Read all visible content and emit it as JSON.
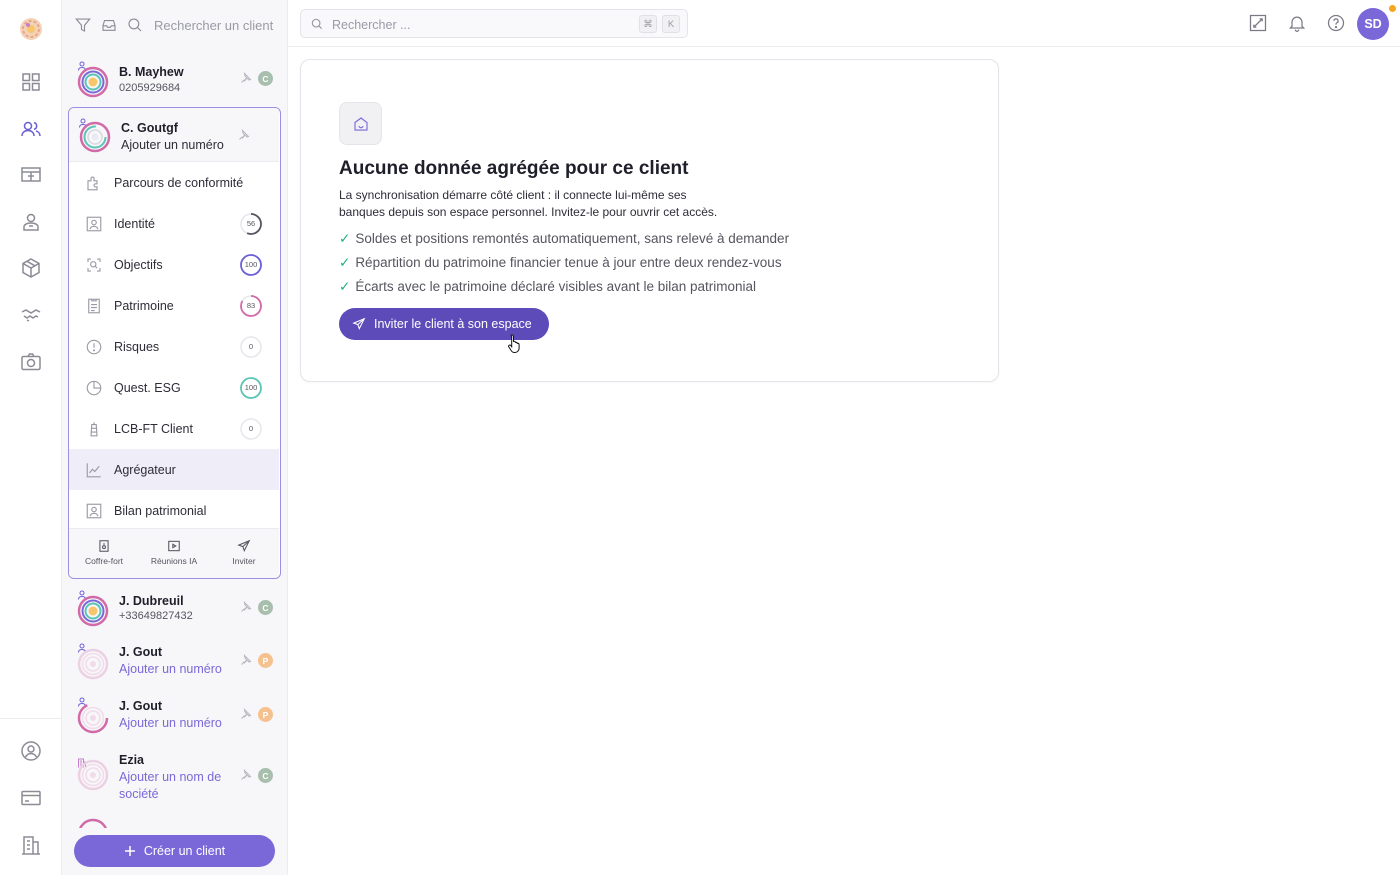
{
  "rail": {
    "icons": [
      "dashboard-icon",
      "clients-icon",
      "presentation-icon",
      "advisor-icon",
      "package-icon",
      "handshake-icon",
      "camera-icon"
    ],
    "bottom_icons": [
      "user-circle-icon",
      "card-icon",
      "building-icon"
    ]
  },
  "clients_panel": {
    "search_placeholder": "Rechercher un client",
    "items": [
      {
        "name": "B. Mayhew",
        "sub": "0205929684",
        "badge": "C"
      },
      {
        "name": "J. Dubreuil",
        "sub": "+33649827432",
        "badge": "C"
      },
      {
        "name": "J. Gout",
        "sub": "Ajouter un numéro",
        "badge": "P"
      },
      {
        "name": "J. Gout",
        "sub": "Ajouter un numéro",
        "badge": "P"
      },
      {
        "name": "Ezia",
        "sub_line1": "Ajouter un nom de",
        "sub_line2": "société",
        "badge": "C"
      }
    ],
    "selected": {
      "name": "C. Goutgf",
      "sub": "Ajouter un numéro",
      "menu": [
        {
          "label": "Parcours de conformité",
          "progress": null
        },
        {
          "label": "Identité",
          "progress": "56"
        },
        {
          "label": "Objectifs",
          "progress": "100"
        },
        {
          "label": "Patrimoine",
          "progress": "83"
        },
        {
          "label": "Risques",
          "progress": "0"
        },
        {
          "label": "Quest. ESG",
          "progress": "100"
        },
        {
          "label": "LCB-FT Client",
          "progress": "0"
        },
        {
          "label": "Agrégateur",
          "progress": null
        },
        {
          "label": "Bilan patrimonial",
          "progress": null
        }
      ],
      "actions": [
        {
          "label": "Coffre-fort"
        },
        {
          "label": "Réunions IA"
        },
        {
          "label": "Inviter"
        }
      ]
    },
    "create_label": "Créer un client"
  },
  "topbar": {
    "search_placeholder": "Rechercher ...",
    "kbd1": "⌘",
    "kbd2": "K",
    "avatar_initials": "SD"
  },
  "main": {
    "title": "Aucune donnée agrégée pour ce client",
    "desc_line1": "La synchronisation démarre côté client : il connecte lui-même ses",
    "desc_line2": "banques depuis son espace personnel. Invitez-le pour ouvrir cet accès.",
    "bullets": [
      "Soldes et positions remontés automatiquement, sans relevé à demander",
      "Répartition du patrimoine financier tenue à jour entre deux rendez-vous",
      "Écarts avec le patrimoine déclaré visibles avant le bilan patrimonial"
    ],
    "check": "✓",
    "invite_label": "Inviter le client à son espace"
  },
  "colors": {
    "accent": "#7b68d8",
    "accent_dark": "#5c4bb8",
    "check": "#22b07d",
    "badge_c": "#a9bfae",
    "badge_p": "#f5c28f",
    "notif": "#f6a623"
  }
}
